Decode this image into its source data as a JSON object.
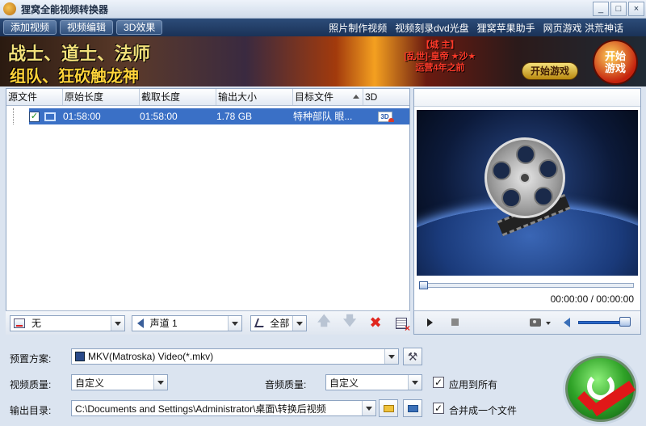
{
  "window": {
    "title": "狸窝全能视频转换器",
    "controls": [
      "_",
      "□",
      "×"
    ]
  },
  "toolbar": {
    "buttons": [
      "添加视频",
      "视频编辑",
      "3D效果"
    ],
    "links": [
      "照片制作视频",
      "视频刻录dvd光盘",
      "狸窝苹果助手",
      "网页游戏 洪荒神话"
    ]
  },
  "banner": {
    "line1": "战士、道士、法师",
    "line2": "组队、狂砍触龙神",
    "promo_title": "【城 主】",
    "promo_line2": "[乱世]-皇帝 ★沙★",
    "promo_line3": "运营4年之前",
    "start_button": "开始游戏",
    "start_round_line1": "开始",
    "start_round_line2": "游戏"
  },
  "file_list": {
    "columns": [
      "源文件",
      "原始长度",
      "截取长度",
      "输出大小",
      "目标文件",
      "3D"
    ],
    "rows": [
      {
        "checked": true,
        "original_length": "01:58:00",
        "cut_length": "01:58:00",
        "output_size": "1.78 GB",
        "target_file": "特种部队 眼...",
        "badge_3d": "3D"
      }
    ]
  },
  "list_controls": {
    "subtitle": "无",
    "audio_track": "声道 1",
    "select_all": "全部"
  },
  "player": {
    "time": "00:00:00 / 00:00:00",
    "seek_progress": 0,
    "volume": 0.85
  },
  "settings": {
    "preset_label": "预置方案:",
    "preset_value": "MKV(Matroska) Video(*.mkv)",
    "video_quality_label": "视频质量:",
    "video_quality_value": "自定义",
    "audio_quality_label": "音频质量:",
    "audio_quality_value": "自定义",
    "apply_all_label": "应用到所有",
    "apply_all_checked": true,
    "output_dir_label": "输出目录:",
    "output_dir_value": "C:\\Documents and Settings\\Administrator\\桌面\\转换后视频",
    "merge_label": "合并成一个文件",
    "merge_checked": true
  },
  "colors": {
    "selection": "#3a70c6",
    "toolbar_bg": "#1a3257",
    "convert_green": "#2fa227",
    "check_red": "#e01818"
  },
  "icons": [
    "app-logo-icon",
    "film-icon",
    "3d-badge-icon",
    "subtitle-icon",
    "speaker-icon",
    "select-all-icon",
    "up-arrow-icon",
    "down-arrow-icon",
    "delete-icon",
    "clear-list-icon",
    "play-icon",
    "stop-icon",
    "camera-icon",
    "volume-icon",
    "mkv-icon",
    "wrench-icon",
    "folder-icon",
    "open-folder-icon",
    "convert-icon",
    "check-icon"
  ]
}
